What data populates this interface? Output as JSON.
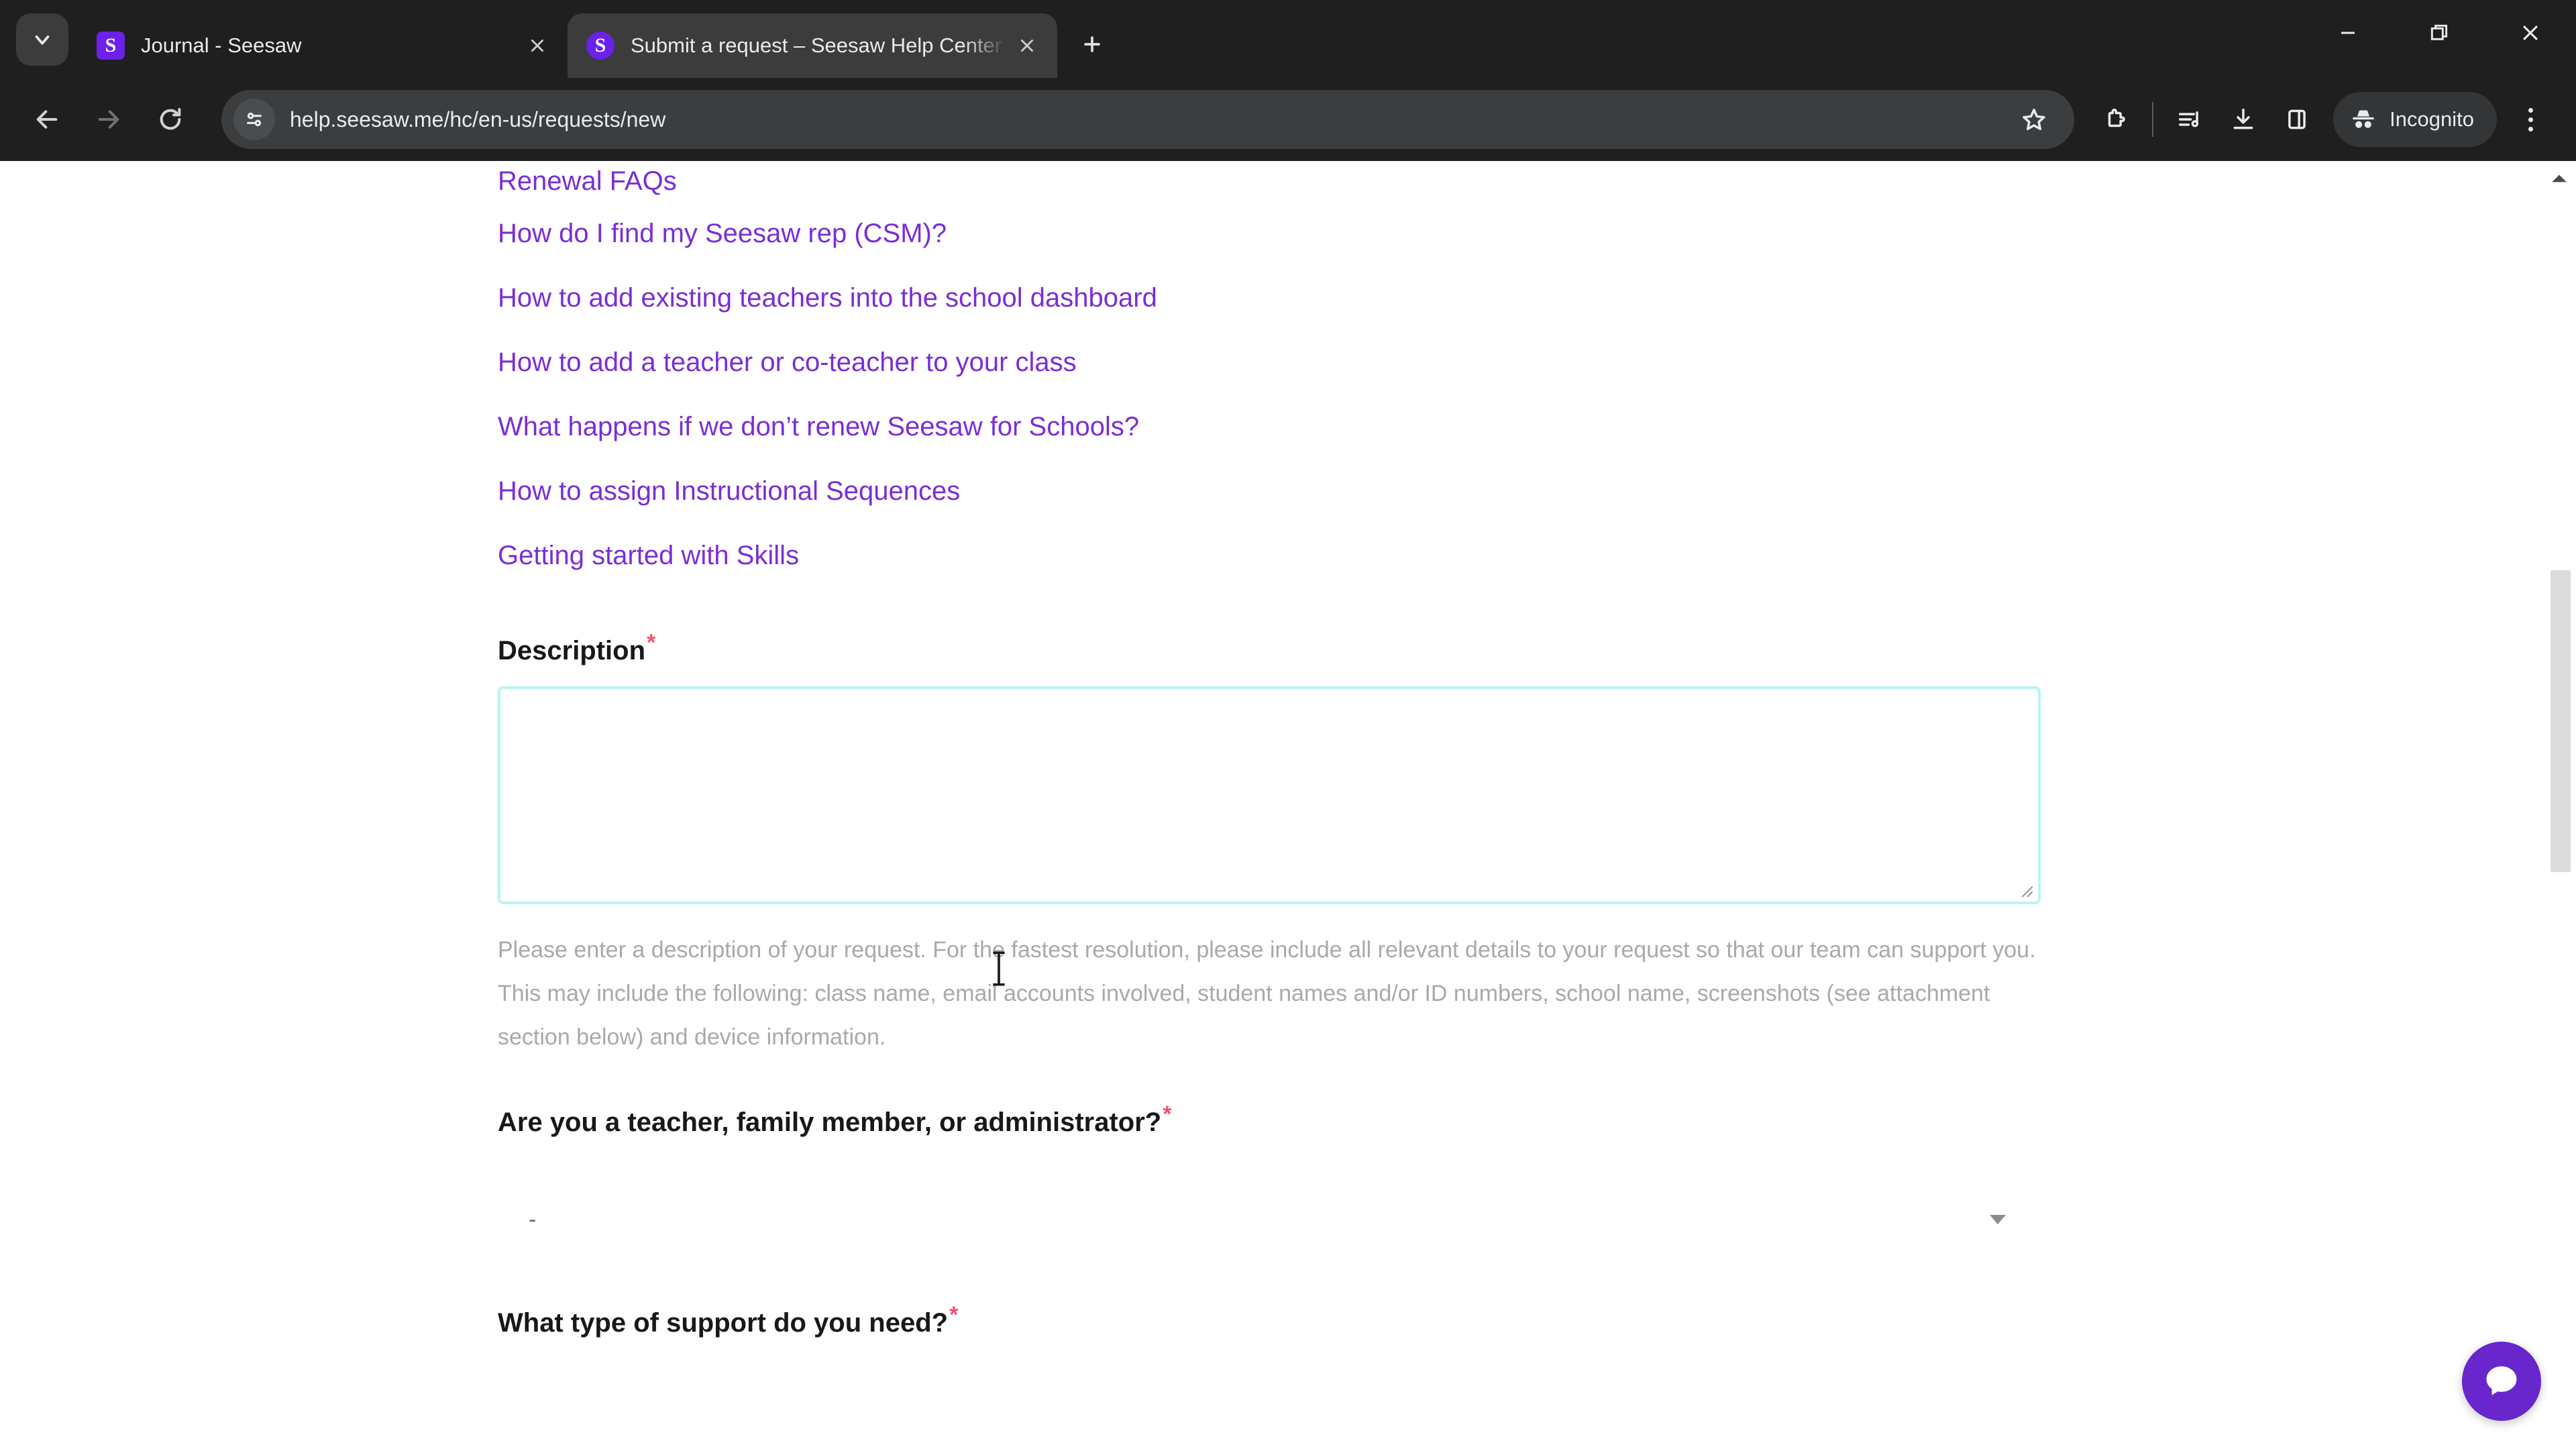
{
  "browser": {
    "tab_search_tooltip": "Search tabs",
    "tabs": [
      {
        "title": "Journal - Seesaw",
        "favicon_letter": "S",
        "active": false
      },
      {
        "title": "Submit a request – Seesaw Help Center",
        "favicon_letter": "S",
        "active": true
      }
    ],
    "new_tab_label": "+",
    "window_controls": {
      "minimize": "minimize-button",
      "maximize": "restore-button",
      "close": "close-button"
    },
    "toolbar": {
      "back": "Back",
      "forward": "Forward",
      "reload": "Reload",
      "url": "help.seesaw.me/hc/en-us/requests/new",
      "site_info": "View site information",
      "bookmark": "Bookmark this tab",
      "extensions": "Extensions",
      "media_list": "Reading list",
      "downloads": "Downloads",
      "side_panel": "Side panel",
      "incognito_label": "Incognito",
      "menu": "Customize and control Google Chrome"
    }
  },
  "page": {
    "suggested_articles": [
      "Renewal FAQs",
      "How do I find my Seesaw rep (CSM)?",
      "How to add existing teachers into the school dashboard",
      "How to add a teacher or co-teacher to your class",
      "What happens if we don’t renew Seesaw for Schools?",
      "How to assign Instructional Sequences",
      "Getting started with Skills"
    ],
    "description_field": {
      "label": "Description",
      "required_marker": "*",
      "value": "",
      "placeholder": "",
      "helper_text": "Please enter a description of your request. For the fastest resolution, please include all relevant details to your request so that our team can support you. This may include the following: class name, email accounts involved, student names and/or ID numbers, school name, screenshots (see attachment section below) and device information."
    },
    "role_field": {
      "label": "Are you a teacher, family member, or administrator?",
      "required_marker": "*",
      "selected_value": "-"
    },
    "support_type_field": {
      "label": "What type of support do you need?",
      "required_marker": "*"
    },
    "chat_widget_label": "Open chat",
    "colors": {
      "link": "#7a2ed6",
      "required_asterisk": "#f4506a",
      "focus_border": "#b9f4f4",
      "chat_button": "#6926cc",
      "helper_text": "#a9a9a9"
    }
  }
}
